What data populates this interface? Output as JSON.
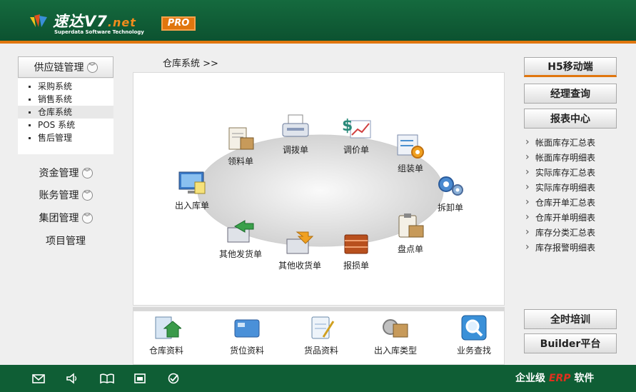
{
  "header": {
    "logo_cn": "速达V7",
    "logo_net": ".net",
    "logo_en": "Superdata Software Technology",
    "pro_badge": "PRO"
  },
  "left_nav": {
    "supply_chain": "供应链管理",
    "supply_items": [
      "采购系统",
      "销售系统",
      "仓库系统",
      "POS 系统",
      "售后管理"
    ],
    "active_item": "仓库系统",
    "groups": [
      "资金管理",
      "账务管理",
      "集团管理"
    ],
    "project": "项目管理"
  },
  "breadcrumb": "仓库系统 >>",
  "flow_items": [
    "领料单",
    "调拨单",
    "调价单",
    "组装单",
    "拆卸单",
    "盘点单",
    "报损单",
    "其他收货单",
    "其他发货单",
    "出入库单"
  ],
  "tools": [
    "仓库资料",
    "货位资料",
    "货品资料",
    "出入库类型",
    "业务查找"
  ],
  "right_nav": {
    "buttons": [
      "H5移动端",
      "经理查询",
      "报表中心"
    ],
    "reports": [
      "帐面库存汇总表",
      "帐面库存明细表",
      "实际库存汇总表",
      "实际库存明细表",
      "仓库开单汇总表",
      "仓库开单明细表",
      "库存分类汇总表",
      "库存报警明细表"
    ],
    "bottom_buttons": [
      "全时培训",
      "Builder平台"
    ]
  },
  "footer": {
    "text_prefix": "企业级",
    "text_erp": "ERP",
    "text_suffix": "软件",
    "icons": [
      "mail-icon",
      "speaker-icon",
      "book-icon",
      "window-icon",
      "check-icon"
    ]
  },
  "colors": {
    "header_green": "#156a3e",
    "accent_orange": "#e0760e",
    "footer_green": "#0f5e35"
  }
}
